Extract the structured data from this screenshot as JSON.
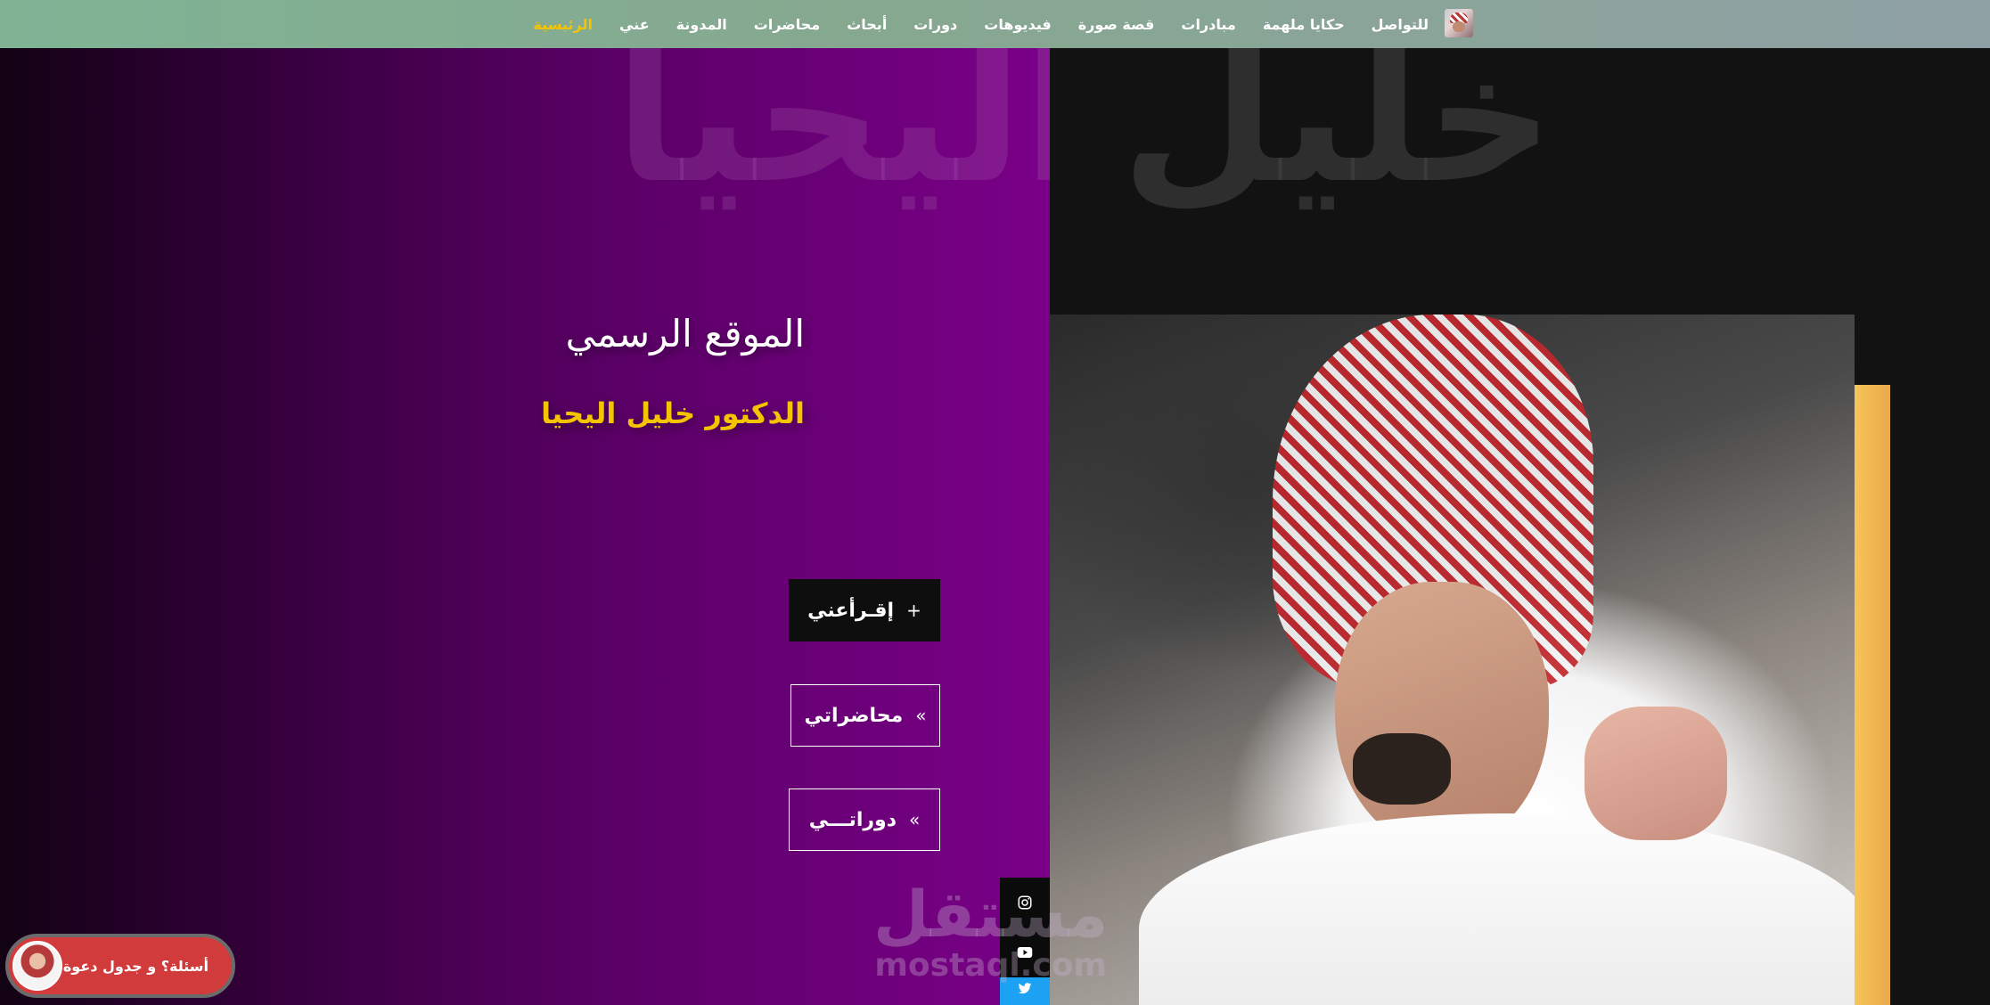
{
  "nav": {
    "items": [
      {
        "label": "الرئيسية",
        "active": true
      },
      {
        "label": "عني"
      },
      {
        "label": "المدونة"
      },
      {
        "label": "محاضرات"
      },
      {
        "label": "أبحاث"
      },
      {
        "label": "دورات"
      },
      {
        "label": "فيديوهات"
      },
      {
        "label": "قصة صورة"
      },
      {
        "label": "مبادرات"
      },
      {
        "label": "حكايا ملهمة"
      },
      {
        "label": "للتواصل"
      }
    ],
    "active_color": "#f5c400"
  },
  "hero": {
    "bg_word_left": "اليحيا",
    "bg_word_right": "خليل",
    "title": "الموقع الرسمي",
    "subtitle": "الدكتور خليل اليحيا",
    "subtitle_color": "#f5c400"
  },
  "buttons": {
    "read": {
      "label": "إقـرأعني",
      "icon": "+"
    },
    "lectures": {
      "label": "محاضراتي",
      "icon": "»"
    },
    "courses": {
      "label": "دوراتـــي",
      "icon": "»"
    }
  },
  "social": {
    "instagram": "instagram-icon",
    "youtube": "youtube-icon",
    "twitter": "twitter-icon"
  },
  "watermark": {
    "arabic": "مستقل",
    "latin": "mostaql.com"
  },
  "chat": {
    "label": "أسئلة؟ و جدول دعوة"
  },
  "colors": {
    "purple": "#7a0088",
    "accent_yellow": "#f5c400",
    "chat_red": "#d23b3b",
    "twitter_blue": "#1da1f2"
  }
}
